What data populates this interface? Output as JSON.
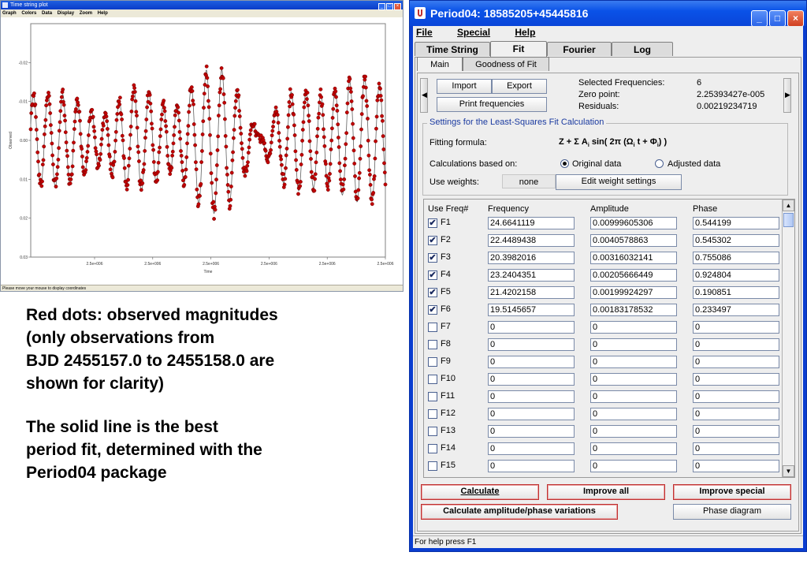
{
  "plot_window": {
    "title": "Time string plot",
    "menu": [
      "Graph",
      "Colors",
      "Data",
      "Display",
      "Zoom",
      "Help"
    ],
    "status": "Please move your mouse to display coordinates"
  },
  "chart_data": {
    "type": "scatter",
    "title": "",
    "xlabel": "Time",
    "ylabel": "Observed",
    "x_ticks": [
      "2.5e+006",
      "2.5e+006",
      "2.5e+006",
      "2.5e+006",
      "2.5e+006",
      "2.5e+006"
    ],
    "y_ticks": [
      "-0.02",
      "-0.01",
      "0.00",
      "0.01",
      "0.02",
      "0.03"
    ],
    "y_inverted": true,
    "ylim": [
      -0.03,
      0.03
    ],
    "series": [
      {
        "kind": "points",
        "color": "#c00000"
      },
      {
        "kind": "line",
        "color": "#606060"
      }
    ]
  },
  "caption": {
    "para1": [
      "Red dots: observed magnitudes",
      "(only observations from",
      "BJD 2455157.0 to 2455158.0 are",
      "shown for clarity)"
    ],
    "para2": [
      "The solid line is the best",
      "period fit, determined with the",
      "Period04 package"
    ]
  },
  "period04": {
    "title": "Period04: 18585205+45445816",
    "menu": {
      "file": "File",
      "special": "Special",
      "help": "Help"
    },
    "tabs": [
      "Time String",
      "Fit",
      "Fourier",
      "Log"
    ],
    "active_tab": "Fit",
    "subtabs": [
      "Main",
      "Goodness of Fit"
    ],
    "buttons": {
      "import": "Import",
      "export": "Export",
      "print": "Print frequencies"
    },
    "info": {
      "selected_label": "Selected Frequencies:",
      "selected_value": "6",
      "zero_label": "Zero point:",
      "zero_value": "2.25393427e-005",
      "res_label": "Residuals:",
      "res_value": "0.00219234719"
    },
    "settings": {
      "title": "Settings for the Least-Squares Fit Calculation",
      "formula_label": "Fitting formula:",
      "calc_label": "Calculations based on:",
      "original": "Original data",
      "adjusted": "Adjusted data",
      "weights_label": "Use weights:",
      "weights_value": "none",
      "edit_weights": "Edit weight settings"
    },
    "table_headers": {
      "use": "Use Freq#",
      "freq": "Frequency",
      "amp": "Amplitude",
      "phase": "Phase"
    },
    "rows": [
      {
        "name": "F1",
        "checked": true,
        "freq": "24.6641119",
        "amp": "0.00999605306",
        "phase": "0.544199"
      },
      {
        "name": "F2",
        "checked": true,
        "freq": "22.4489438",
        "amp": "0.0040578863",
        "phase": "0.545302"
      },
      {
        "name": "F3",
        "checked": true,
        "freq": "20.3982016",
        "amp": "0.00316032141",
        "phase": "0.755086"
      },
      {
        "name": "F4",
        "checked": true,
        "freq": "23.2404351",
        "amp": "0.00205666449",
        "phase": "0.924804"
      },
      {
        "name": "F5",
        "checked": true,
        "freq": "21.4202158",
        "amp": "0.00199924297",
        "phase": "0.190851"
      },
      {
        "name": "F6",
        "checked": true,
        "freq": "19.5145657",
        "amp": "0.00183178532",
        "phase": "0.233497"
      },
      {
        "name": "F7",
        "checked": false,
        "freq": "0",
        "amp": "0",
        "phase": "0"
      },
      {
        "name": "F8",
        "checked": false,
        "freq": "0",
        "amp": "0",
        "phase": "0"
      },
      {
        "name": "F9",
        "checked": false,
        "freq": "0",
        "amp": "0",
        "phase": "0"
      },
      {
        "name": "F10",
        "checked": false,
        "freq": "0",
        "amp": "0",
        "phase": "0"
      },
      {
        "name": "F11",
        "checked": false,
        "freq": "0",
        "amp": "0",
        "phase": "0"
      },
      {
        "name": "F12",
        "checked": false,
        "freq": "0",
        "amp": "0",
        "phase": "0"
      },
      {
        "name": "F13",
        "checked": false,
        "freq": "0",
        "amp": "0",
        "phase": "0"
      },
      {
        "name": "F14",
        "checked": false,
        "freq": "0",
        "amp": "0",
        "phase": "0"
      },
      {
        "name": "F15",
        "checked": false,
        "freq": "0",
        "amp": "0",
        "phase": "0"
      }
    ],
    "actions": {
      "calculate": "Calculate",
      "improve_all": "Improve all",
      "improve_special": "Improve special",
      "calc_amp_phase": "Calculate amplitude/phase variations",
      "phase_diagram": "Phase diagram"
    },
    "status": "For help press F1"
  }
}
